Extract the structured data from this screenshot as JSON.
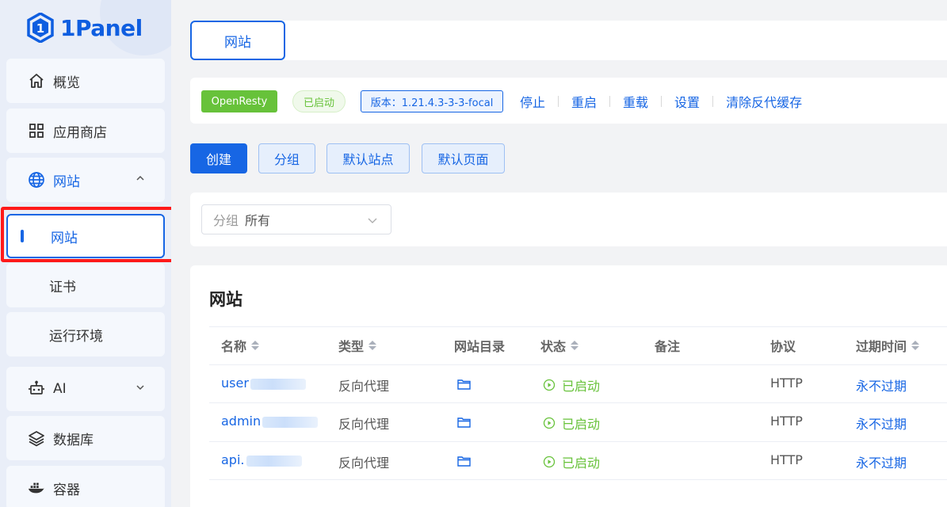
{
  "app": {
    "logo_text": "1Panel"
  },
  "sidebar": {
    "items": [
      {
        "label": "概览",
        "icon": "home-icon"
      },
      {
        "label": "应用商店",
        "icon": "apps-grid-icon"
      },
      {
        "label": "网站",
        "icon": "globe-icon",
        "expanded": true
      },
      {
        "label": "AI",
        "icon": "robot-icon"
      },
      {
        "label": "数据库",
        "icon": "layers-icon"
      },
      {
        "label": "容器",
        "icon": "docker-whale-icon"
      }
    ],
    "submenu": [
      {
        "label": "网站",
        "active": true
      },
      {
        "label": "证书"
      },
      {
        "label": "运行环境"
      }
    ]
  },
  "tabs": {
    "active": "网站"
  },
  "status_bar": {
    "app_name": "OpenResty",
    "state": "已启动",
    "version": "版本：1.21.4.3-3-3-focal",
    "actions": [
      "停止",
      "重启",
      "重载",
      "设置",
      "清除反代缓存"
    ]
  },
  "toolbar": {
    "create": "创建",
    "group": "分组",
    "default_site": "默认站点",
    "default_page": "默认页面"
  },
  "filter": {
    "prefix": "分组",
    "value": "所有"
  },
  "table": {
    "title": "网站",
    "columns": [
      "名称",
      "类型",
      "网站目录",
      "状态",
      "备注",
      "协议",
      "过期时间"
    ],
    "rows": [
      {
        "name": "user",
        "type": "反向代理",
        "status": "已启动",
        "remark": "",
        "protocol": "HTTP",
        "expire": "永不过期"
      },
      {
        "name": "admin",
        "type": "反向代理",
        "status": "已启动",
        "remark": "",
        "protocol": "HTTP",
        "expire": "永不过期"
      },
      {
        "name": "api.",
        "type": "反向代理",
        "status": "已启动",
        "remark": "",
        "protocol": "HTTP",
        "expire": "永不过期"
      }
    ]
  },
  "colors": {
    "primary": "#1766e4",
    "success": "#67c23a",
    "highlight": "#ff1a1a"
  }
}
